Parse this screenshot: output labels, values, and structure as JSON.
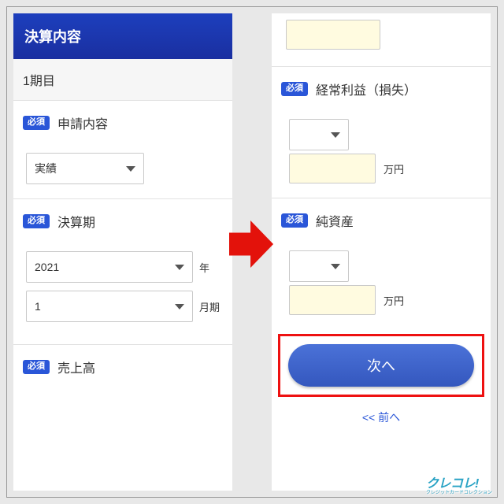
{
  "left": {
    "header": "決算内容",
    "period_label": "1期目",
    "required_label": "必須",
    "sections": {
      "application": {
        "title": "申請内容",
        "select_value": "実績"
      },
      "fiscal": {
        "title": "決算期",
        "year_value": "2021",
        "year_suffix": "年",
        "month_value": "1",
        "month_suffix": "月期"
      },
      "sales": {
        "title": "売上高"
      }
    }
  },
  "right": {
    "required_label": "必須",
    "ordinary_profit": {
      "title": "経常利益（損失）",
      "unit": "万円"
    },
    "net_assets": {
      "title": "純資産",
      "unit": "万円"
    },
    "next_button": "次へ",
    "prev_link": "<< 前へ"
  },
  "watermark": "クレコレ!",
  "watermark_sub": "クレジットカードコレクション"
}
